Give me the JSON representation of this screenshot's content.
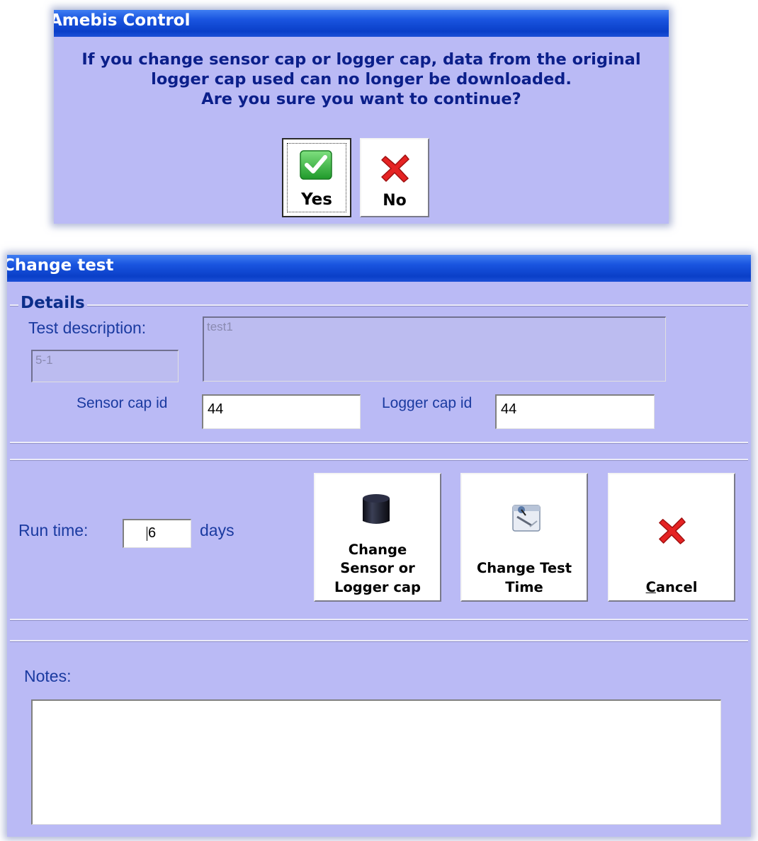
{
  "confirm_dialog": {
    "title": "Amebis Control",
    "message_lines": [
      "If you change sensor cap or logger cap, data from the original",
      "logger cap used can no longer be downloaded.",
      "Are you sure you want to continue?"
    ],
    "yes_label": "Yes",
    "no_label": "No"
  },
  "change_test_dialog": {
    "title": "Change test",
    "details_legend": "Details",
    "test_description_label": "Test description:",
    "test_id_value": "5-1",
    "test_description_value": "test1",
    "sensor_cap_label": "Sensor cap id",
    "sensor_cap_value": "44",
    "logger_cap_label": "Logger cap id",
    "logger_cap_value": "44",
    "run_time_label": "Run time:",
    "run_time_value": "6",
    "run_time_unit": "days",
    "change_cap_button_lines": [
      "Change",
      "Sensor or",
      "Logger cap"
    ],
    "change_time_button_lines": [
      "Change Test",
      "Time"
    ],
    "cancel_button_mnemonic": "C",
    "cancel_button_rest": "ancel",
    "notes_label": "Notes:",
    "notes_value": ""
  },
  "colors": {
    "dialog_bg": "#babaf5",
    "title_bar": "#1a55e0",
    "text_dark_blue": "#0b1f8a",
    "label_blue": "#1a3aa0",
    "check_green": "#3bb43b",
    "cross_red": "#e02020"
  },
  "icons": [
    "check-icon",
    "cross-icon",
    "sensor-cap-icon",
    "clock-document-icon"
  ]
}
